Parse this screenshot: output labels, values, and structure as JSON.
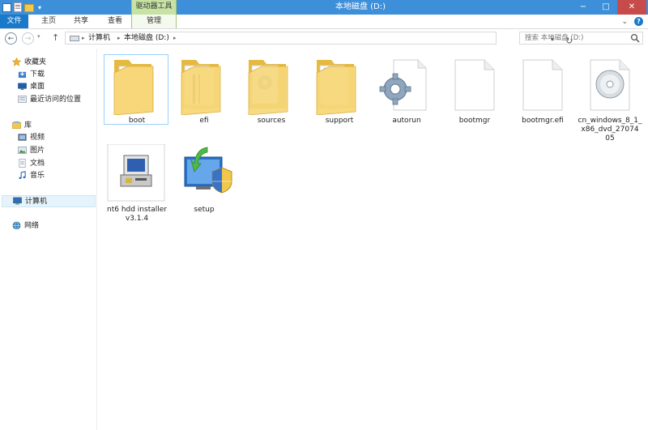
{
  "window": {
    "title": "本地磁盘 (D:)",
    "context_tab_group": "驱动器工具",
    "controls": {
      "minimize": "−",
      "maximize": "□",
      "close": "✕"
    }
  },
  "ribbon": {
    "tabs": [
      {
        "label": "文件",
        "active": true
      },
      {
        "label": "主页"
      },
      {
        "label": "共享"
      },
      {
        "label": "查看"
      },
      {
        "label": "管理"
      }
    ],
    "collapse_glyph": "⌄",
    "help_glyph": "?"
  },
  "address": {
    "back_glyph": "←",
    "forward_glyph": "→",
    "dropdown_glyph": "▾",
    "up_glyph": "↑",
    "refresh_glyph": "↻",
    "separator_glyph": "▸",
    "breadcrumb": [
      "计算机",
      "本地磁盘 (D:)"
    ]
  },
  "search": {
    "placeholder": "搜索 本地磁盘 (D:)"
  },
  "nav": {
    "favorites": {
      "label": "收藏夹",
      "items": [
        {
          "label": "下载",
          "icon": "download-icon"
        },
        {
          "label": "桌面",
          "icon": "desktop-icon"
        },
        {
          "label": "最近访问的位置",
          "icon": "recent-places-icon"
        }
      ]
    },
    "libraries": {
      "label": "库",
      "items": [
        {
          "label": "视频",
          "icon": "video-icon"
        },
        {
          "label": "图片",
          "icon": "pictures-icon"
        },
        {
          "label": "文档",
          "icon": "documents-icon"
        },
        {
          "label": "音乐",
          "icon": "music-icon"
        }
      ]
    },
    "computer": {
      "label": "计算机",
      "selected": true
    },
    "network": {
      "label": "网络"
    }
  },
  "files": [
    {
      "name": "boot",
      "type": "folder",
      "selected": true
    },
    {
      "name": "efi",
      "type": "folder"
    },
    {
      "name": "sources",
      "type": "folder"
    },
    {
      "name": "support",
      "type": "folder"
    },
    {
      "name": "autorun",
      "type": "settings-file"
    },
    {
      "name": "bootmgr",
      "type": "file"
    },
    {
      "name": "bootmgr.efi",
      "type": "file"
    },
    {
      "name": "cn_windows_8_1_x86_dvd_27074 05",
      "type": "disc-image"
    },
    {
      "name": "nt6 hdd installer v3.1.4",
      "type": "installer"
    },
    {
      "name": "setup",
      "type": "setup-exe"
    }
  ],
  "colors": {
    "titlebar": "#3d8fd9",
    "file_tab": "#1979ca",
    "context_tab": "#c6e3a4",
    "selection": "#99d1ff",
    "folder": "#f2c94c"
  }
}
